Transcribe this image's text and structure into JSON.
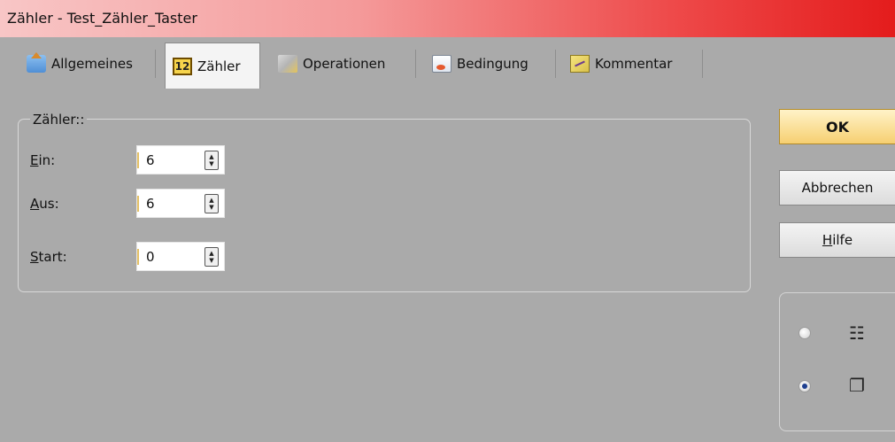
{
  "window": {
    "title": "Zähler - Test_Zähler_Taster"
  },
  "tabs": [
    {
      "label": "Allgemeines",
      "icon": "general-settings-icon"
    },
    {
      "label": "Zähler",
      "icon": "counter-12-icon",
      "icon_text": "12",
      "active": true
    },
    {
      "label": "Operationen",
      "icon": "operations-icon"
    },
    {
      "label": "Bedingung",
      "icon": "condition-icon"
    },
    {
      "label": "Kommentar",
      "icon": "comment-icon"
    }
  ],
  "group": {
    "legend": "Zähler::",
    "fields": [
      {
        "label_mn": "E",
        "label_rest": "in:",
        "value": "6"
      },
      {
        "label_mn": "A",
        "label_rest": "us:",
        "value": "6"
      },
      {
        "label_mn": "S",
        "label_rest": "tart:",
        "value": "0"
      }
    ]
  },
  "buttons": {
    "ok": "OK",
    "cancel": "Abbrechen",
    "help_mn": "H",
    "help_rest": "ilfe"
  },
  "view": {
    "options": [
      {
        "icon": "list-view-icon",
        "checked": false
      },
      {
        "icon": "multi-window-view-icon",
        "checked": true
      }
    ]
  },
  "colors": {
    "title_gradient_end": "#e41c1c",
    "background": "#aaaaaa",
    "ok_button": "#f6cf71"
  }
}
